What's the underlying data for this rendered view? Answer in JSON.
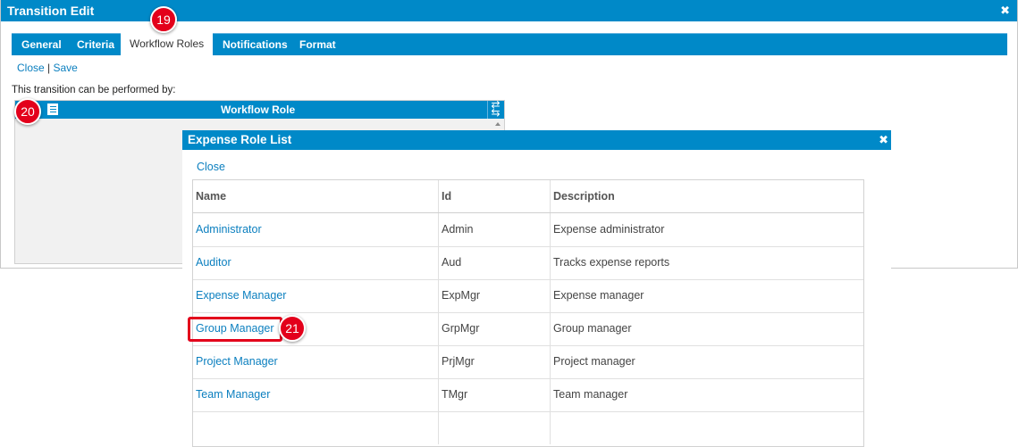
{
  "main": {
    "title": "Transition Edit",
    "close_icon": "close-icon",
    "tabs": [
      {
        "label": "General"
      },
      {
        "label": "Criteria"
      },
      {
        "label": "Workflow Roles",
        "active": true
      },
      {
        "label": "Notifications"
      },
      {
        "label": "Format"
      }
    ],
    "actions": {
      "close": "Close",
      "separator": "|",
      "save": "Save"
    },
    "performed_label": "This transition can be performed by:",
    "grid": {
      "column": "Workflow Role"
    }
  },
  "dialog": {
    "title": "Expense Role List",
    "close_link": "Close",
    "columns": {
      "name": "Name",
      "id": "Id",
      "description": "Description"
    },
    "rows": [
      {
        "name": "Administrator",
        "id": "Admin",
        "description": "Expense administrator"
      },
      {
        "name": "Auditor",
        "id": "Aud",
        "description": "Tracks expense reports"
      },
      {
        "name": "Expense Manager",
        "id": "ExpMgr",
        "description": "Expense manager"
      },
      {
        "name": "Group Manager",
        "id": "GrpMgr",
        "description": "Group manager"
      },
      {
        "name": "Project Manager",
        "id": "PrjMgr",
        "description": "Project manager"
      },
      {
        "name": "Team Manager",
        "id": "TMgr",
        "description": "Team manager"
      }
    ]
  },
  "badges": {
    "b19": "19",
    "b20": "20",
    "b21": "21"
  },
  "colors": {
    "titlebar": "#0089c8",
    "link": "#0b7fbf",
    "badge": "#e3001b"
  }
}
